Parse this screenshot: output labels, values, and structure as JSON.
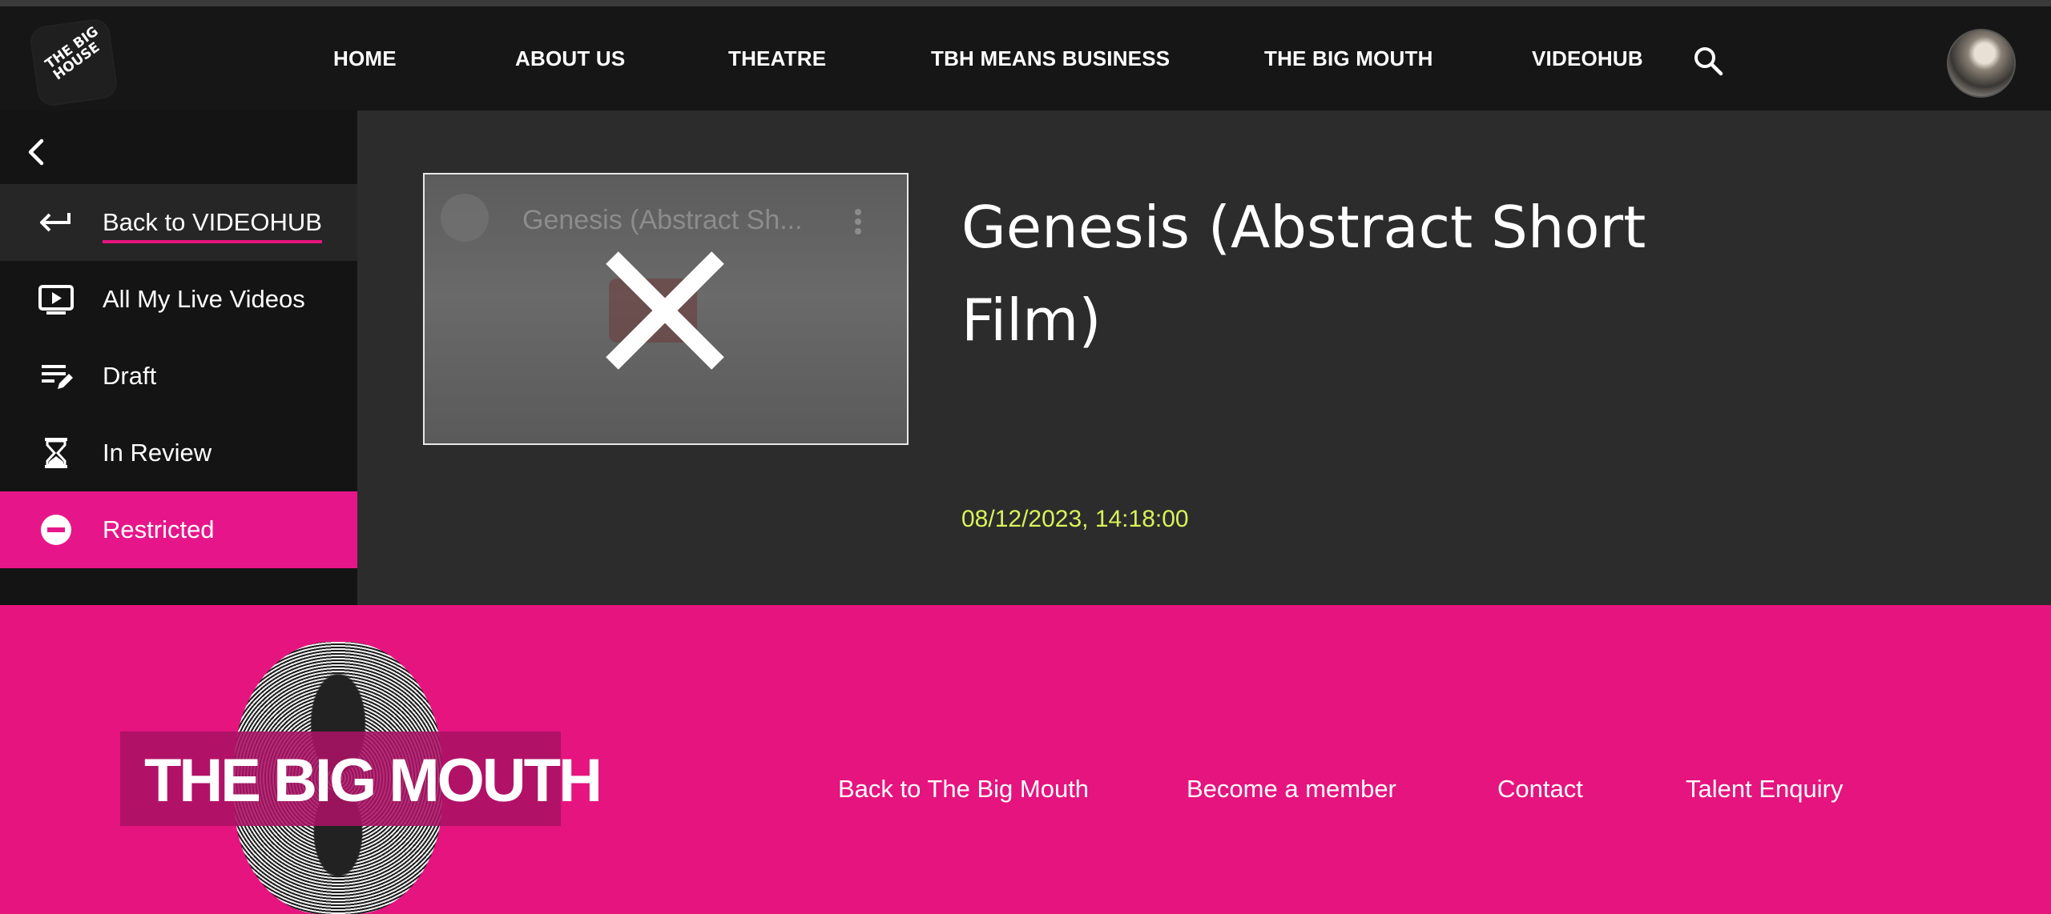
{
  "header": {
    "logo_text": "THE BIG HOUSE",
    "nav": [
      {
        "label": "HOME"
      },
      {
        "label": "ABOUT US"
      },
      {
        "label": "THEATRE"
      },
      {
        "label": "TBH MEANS BUSINESS"
      },
      {
        "label": "THE BIG MOUTH"
      },
      {
        "label": "VIDEOHUB"
      }
    ],
    "search_icon": "search-icon",
    "avatar_icon": "user-avatar"
  },
  "sidebar": {
    "back_icon": "chevron-left-icon",
    "items": [
      {
        "label": "Back to VIDEOHUB",
        "icon": "arrow-back-icon"
      },
      {
        "label": "All My Live Videos",
        "icon": "live-video-icon"
      },
      {
        "label": "Draft",
        "icon": "draft-edit-icon"
      },
      {
        "label": "In Review",
        "icon": "hourglass-icon"
      },
      {
        "label": "Restricted",
        "icon": "minus-circle-icon"
      }
    ],
    "active_item": "Restricted",
    "accent_color": "#e6168a"
  },
  "main": {
    "thumbnail": {
      "overlay_title": "Genesis (Abstract Sh...",
      "status_icon": "close-x-icon"
    },
    "title": "Genesis (Abstract Short Film)",
    "date": "08/12/2023, 14:18:00",
    "date_color": "#d9f25a"
  },
  "footer": {
    "brand": "THE BIG MOUTH",
    "links": [
      {
        "label": "Back to The Big Mouth"
      },
      {
        "label": "Become a member"
      },
      {
        "label": "Contact"
      },
      {
        "label": "Talent Enquiry"
      }
    ],
    "background_color": "#e5147f"
  }
}
